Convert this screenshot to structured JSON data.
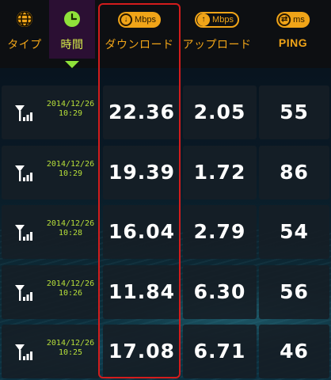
{
  "header": {
    "type_label": "タイプ",
    "time_label": "時間",
    "download_label": "ダウンロード",
    "upload_label": "アップロード",
    "ping_label": "PING",
    "download_unit": "Mbps",
    "upload_unit": "Mbps",
    "ping_unit": "ms"
  },
  "rows": [
    {
      "date": "2014/12/26",
      "time": "10:29",
      "download": "22.36",
      "upload": "2.05",
      "ping": "55"
    },
    {
      "date": "2014/12/26",
      "time": "10:29",
      "download": "19.39",
      "upload": "1.72",
      "ping": "86"
    },
    {
      "date": "2014/12/26",
      "time": "10:28",
      "download": "16.04",
      "upload": "2.79",
      "ping": "54"
    },
    {
      "date": "2014/12/26",
      "time": "10:26",
      "download": "11.84",
      "upload": "6.30",
      "ping": "56"
    },
    {
      "date": "2014/12/26",
      "time": "10:25",
      "download": "17.08",
      "upload": "6.71",
      "ping": "46"
    }
  ],
  "icons": {
    "type": "globe-icon",
    "time": "clock-icon",
    "download": "download-arrow-icon",
    "upload": "upload-arrow-icon",
    "ping": "ping-arrows-icon",
    "signal": "signal-strength-icon"
  },
  "colors": {
    "accent_orange": "#f0a418",
    "time_green": "#b8e03a",
    "highlight_red": "#d31c1c"
  }
}
